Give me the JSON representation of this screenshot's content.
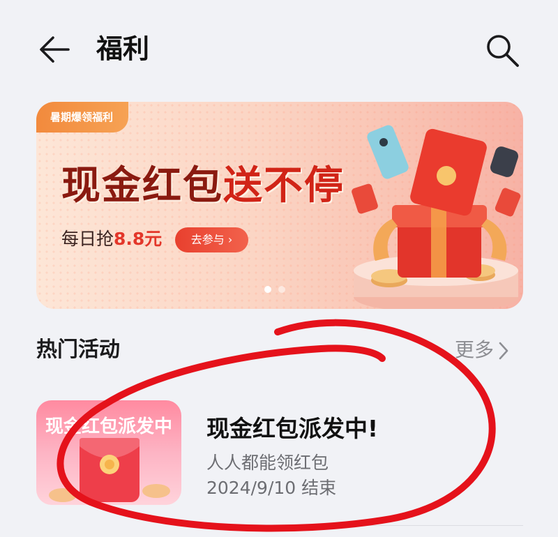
{
  "header": {
    "title": "福利",
    "back_icon": "arrow-left-icon",
    "search_icon": "search-icon"
  },
  "banner": {
    "tag": "暑期爆领福利",
    "headline_main": "现金红包",
    "headline_suffix": "送不停",
    "sub_prefix": "每日抢",
    "sub_amount": "8.8元",
    "cta": "去参与 ›",
    "pager_total": 2,
    "pager_active": 1,
    "colors": {
      "tag": "#f28a3d",
      "cta": "#e8402e",
      "headline": "#8a1a10"
    }
  },
  "hot": {
    "title": "热门活动",
    "more": "更多",
    "items": [
      {
        "thumb_caption": "现金红包派发中",
        "title": "现金红包派发中!",
        "desc": "人人都能领红包",
        "end": "2024/9/10 结束"
      }
    ]
  },
  "annotation": {
    "color": "#e5121b",
    "shape": "hand-drawn-ellipse"
  }
}
